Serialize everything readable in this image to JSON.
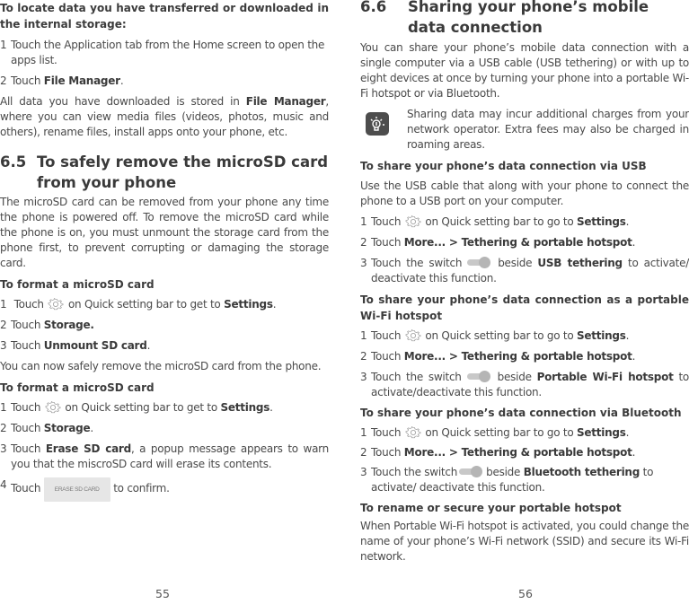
{
  "left_page": {
    "intro_heading": "To locate data you have transferred or downloaded in the internal storage:",
    "intro_steps": [
      {
        "n": "1",
        "text": "Touch the Application tab from the Home screen to open the apps list."
      },
      {
        "n": "2",
        "pre": "Touch ",
        "bold": "File Manager",
        "post": "."
      }
    ],
    "intro_para": {
      "pre": "All data you have downloaded is stored in ",
      "bold": "File Manager",
      "post": ", where you can view media files (videos, photos, music and others), rename files, install apps onto your phone, etc."
    },
    "section": {
      "number": "6.5",
      "title": "To safely remove the microSD card from your phone"
    },
    "section_para": "The microSD card can be removed from your phone any time the phone is powered off. To remove the microSD card while the phone is on, you must unmount the storage card from the phone first, to prevent corrupting or damaging the storage card.",
    "sub1": {
      "heading": "To format a microSD card",
      "step1": {
        "n": "1",
        "pre": "Touch",
        "post": "on Quick setting bar to get to ",
        "bold": "Settings",
        "end": "."
      },
      "step2": {
        "n": "2",
        "pre": "Touch ",
        "bold": "Storage."
      },
      "step3": {
        "n": "3",
        "pre": "Touch ",
        "bold": "Unmount SD card",
        "post": "."
      },
      "after": "You can now safely remove the microSD card from the phone."
    },
    "sub2": {
      "heading": "To format a microSD card",
      "step1": {
        "n": "1",
        "pre": "Touch",
        "post": "on Quick setting bar to get to ",
        "bold": "Settings",
        "end": "."
      },
      "step2": {
        "n": "2",
        "pre": "Touch ",
        "bold": "Storage",
        "post": "."
      },
      "step3": {
        "n": "3",
        "pre": "Touch ",
        "bold": "Erase SD card",
        "post": ", a popup message appears to warn you that the miscroSD card will erase its contents."
      },
      "step4": {
        "n": "4",
        "pre": "Touch",
        "button": "ERASE SD CARD",
        "post": "to confirm."
      }
    },
    "page_number": "55"
  },
  "right_page": {
    "section": {
      "number": "6.6",
      "title": "Sharing your phone’s mobile data connection"
    },
    "intro": "You can share your phone’s mobile data connection with a single computer via a USB cable (USB tethering) or with up to eight devices at once by turning your phone into a portable Wi-Fi hotspot or via Bluetooth.",
    "tip": "Sharing data may incur additional charges from your network operator. Extra fees may also be charged in roaming areas.",
    "usb": {
      "heading": "To share your phone’s data connection via USB",
      "para": "Use the USB cable that along with your phone to connect the phone to a USB port on your computer.",
      "step1": {
        "n": "1",
        "pre": "Touch",
        "post": "on Quick setting bar to go to ",
        "bold": "Settings",
        "end": "."
      },
      "step2": {
        "n": "2",
        "pre": "Touch ",
        "bold": "More... > Tethering & portable hotspot",
        "post": "."
      },
      "step3": {
        "n": "3",
        "pre": "Touch the switch",
        "mid": "beside ",
        "bold": "USB tethering",
        "post": " to activate/ deactivate this function."
      }
    },
    "wifi": {
      "heading": "To share your phone’s data connection as a portable Wi-Fi hotspot",
      "step1": {
        "n": "1",
        "pre": "Touch",
        "post": "on Quick setting bar to go to ",
        "bold": "Settings",
        "end": "."
      },
      "step2": {
        "n": "2",
        "pre": "Touch ",
        "bold": "More... > Tethering & portable hotspot",
        "post": "."
      },
      "step3": {
        "n": "3",
        "pre": "Touch the switch",
        "mid": "beside ",
        "bold": "Portable Wi-Fi hotspot",
        "post": " to activate/deactivate this function."
      }
    },
    "bt": {
      "heading": "To share your phone’s data connection via Bluetooth",
      "step1": {
        "n": "1",
        "pre": "Touch",
        "post": "on Quick setting bar to go to ",
        "bold": "Settings",
        "end": "."
      },
      "step2": {
        "n": "2",
        "pre": "Touch ",
        "bold": "More... > Tethering & portable hotspot",
        "post": "."
      },
      "step3": {
        "n": "3",
        "pre": "Touch the switch",
        "mid": "beside ",
        "bold": "Bluetooth tethering",
        "post": " to activate/ deactivate this function."
      }
    },
    "rename": {
      "heading": "To rename or secure your portable hotspot",
      "para": "When Portable Wi-Fi hotspot is activated, you could change the name of your phone’s Wi-Fi network (SSID) and secure its Wi-Fi network."
    },
    "page_number": "56"
  }
}
